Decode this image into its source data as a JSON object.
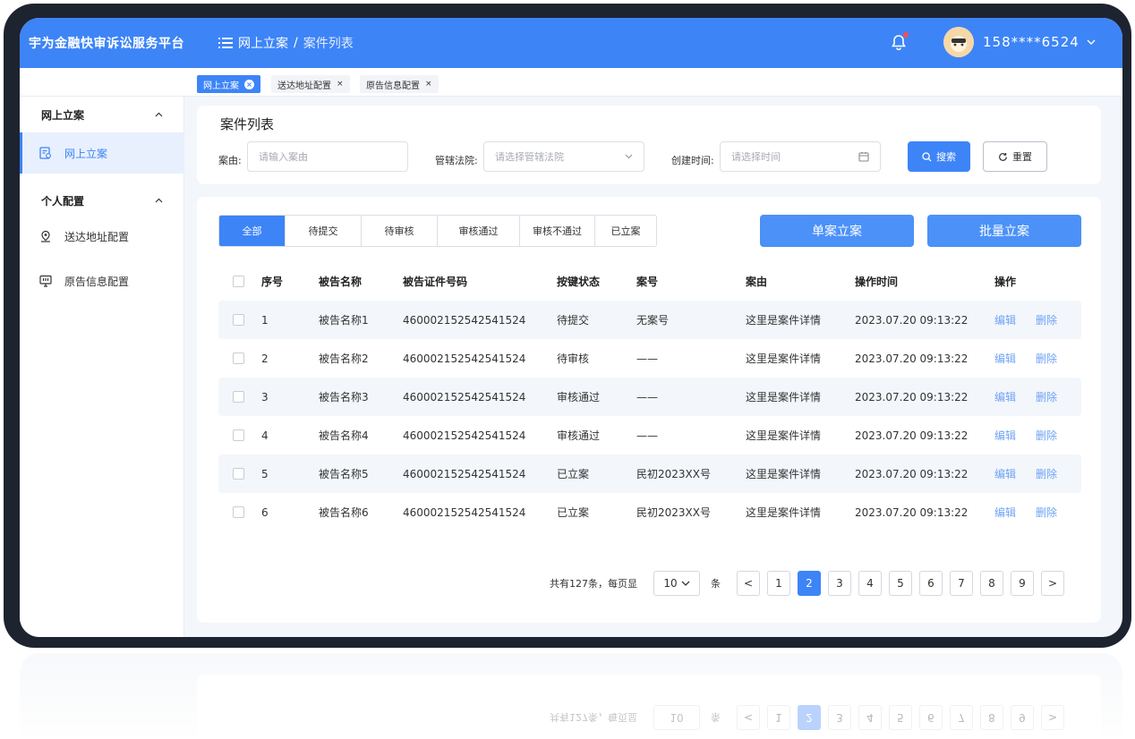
{
  "app": {
    "title": "宇为金融快审诉讼服务平台",
    "breadcrumb": [
      "网上立案",
      "/",
      "案件列表"
    ],
    "user": "158****6524"
  },
  "tags": [
    {
      "label": "网上立案",
      "active": true
    },
    {
      "label": "送达地址配置",
      "active": false
    },
    {
      "label": "原告信息配置",
      "active": false
    }
  ],
  "tag_close": "×",
  "sidebar": {
    "groups": [
      {
        "label": "网上立案",
        "items": [
          {
            "label": "网上立案",
            "icon": "case-register-icon",
            "active": true
          }
        ]
      },
      {
        "label": "个人配置",
        "items": [
          {
            "label": "送达地址配置",
            "icon": "location-icon",
            "active": false
          },
          {
            "label": "原告信息配置",
            "icon": "monitor-icon",
            "active": false
          }
        ]
      }
    ]
  },
  "filters": {
    "title": "案件列表",
    "case_cause_label": "案由:",
    "case_cause_placeholder": "请输入案由",
    "court_label": "管辖法院:",
    "court_placeholder": "请选择管辖法院",
    "created_label": "创建时间:",
    "created_placeholder": "请选择时间",
    "search_btn": "搜索",
    "reset_btn": "重置"
  },
  "status_tabs": [
    {
      "label": "全部",
      "active": true
    },
    {
      "label": "待提交",
      "active": false
    },
    {
      "label": "待审核",
      "active": false
    },
    {
      "label": "审核通过",
      "active": false
    },
    {
      "label": "审核不通过",
      "active": false
    },
    {
      "label": "已立案",
      "active": false
    }
  ],
  "actions": {
    "single": "单案立案",
    "batch": "批量立案"
  },
  "table": {
    "headers": [
      "序号",
      "被告名称",
      "被告证件号码",
      "按键状态",
      "案号",
      "案由",
      "操作时间",
      "操作"
    ],
    "rows": [
      {
        "no": "1",
        "name": "被告名称1",
        "id": "460002152542541524",
        "status": "待提交",
        "case_no": "无案号",
        "cause": "这里是案件详情",
        "time": "2023.07.20 09:13:22"
      },
      {
        "no": "2",
        "name": "被告名称2",
        "id": "460002152542541524",
        "status": "待审核",
        "case_no": "——",
        "cause": "这里是案件详情",
        "time": "2023.07.20 09:13:22"
      },
      {
        "no": "3",
        "name": "被告名称3",
        "id": "460002152542541524",
        "status": "审核通过",
        "case_no": "——",
        "cause": "这里是案件详情",
        "time": "2023.07.20 09:13:22"
      },
      {
        "no": "4",
        "name": "被告名称4",
        "id": "460002152542541524",
        "status": "审核通过",
        "case_no": "——",
        "cause": "这里是案件详情",
        "time": "2023.07.20 09:13:22"
      },
      {
        "no": "5",
        "name": "被告名称5",
        "id": "460002152542541524",
        "status": "已立案",
        "case_no": "民初2023XX号",
        "cause": "这里是案件详情",
        "time": "2023.07.20 09:13:22"
      },
      {
        "no": "6",
        "name": "被告名称6",
        "id": "460002152542541524",
        "status": "已立案",
        "case_no": "民初2023XX号",
        "cause": "这里是案件详情",
        "time": "2023.07.20 09:13:22"
      }
    ],
    "edit": "编辑",
    "delete": "删除"
  },
  "pagination": {
    "total_text": "共有127条，每页显",
    "page_size": "10",
    "unit": "条",
    "prev": "<",
    "next": ">",
    "pages": [
      "1",
      "2",
      "3",
      "4",
      "5",
      "6",
      "7",
      "8",
      "9"
    ],
    "current": "2"
  },
  "colors": {
    "accent": "#3d84f7",
    "link": "#6fa3f5",
    "bg": "#f3f6fb"
  }
}
